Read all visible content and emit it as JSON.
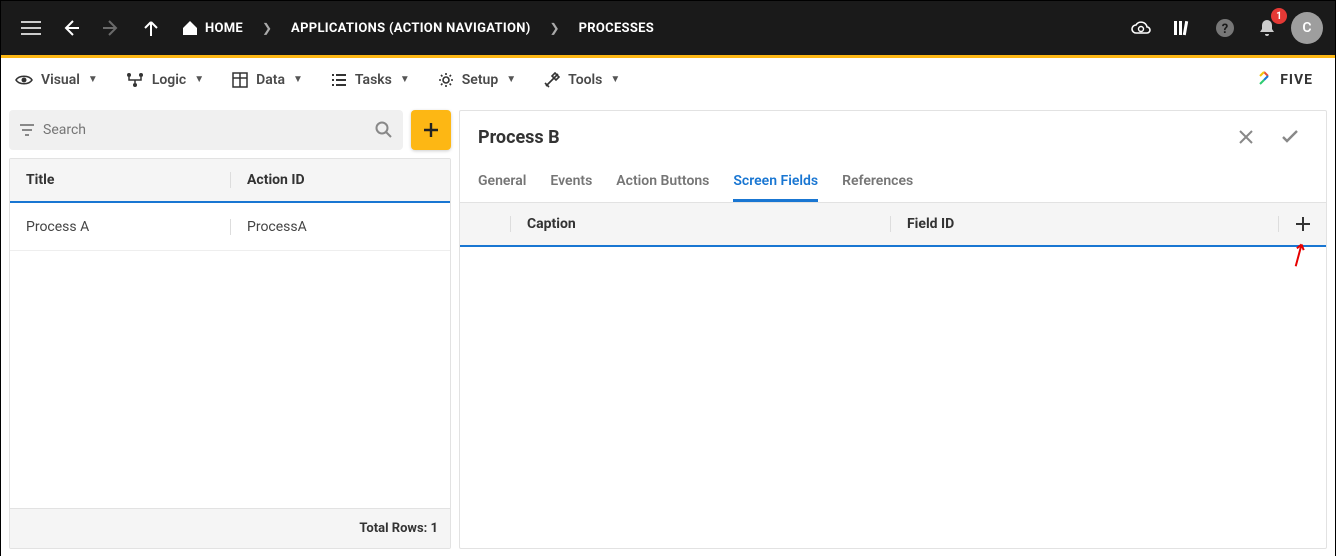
{
  "topbar": {
    "home_label": "HOME",
    "crumb1": "APPLICATIONS (ACTION NAVIGATION)",
    "crumb2": "PROCESSES",
    "notif_count": "1",
    "avatar_letter": "C"
  },
  "toolbar": {
    "visual": "Visual",
    "logic": "Logic",
    "data": "Data",
    "tasks": "Tasks",
    "setup": "Setup",
    "tools": "Tools",
    "logo": "FIVE"
  },
  "left": {
    "search_placeholder": "Search",
    "col_title": "Title",
    "col_actionid": "Action ID",
    "rows": [
      {
        "title": "Process A",
        "actionid": "ProcessA"
      }
    ],
    "total_label": "Total Rows: 1"
  },
  "right": {
    "title": "Process B",
    "tabs": {
      "general": "General",
      "events": "Events",
      "action_buttons": "Action Buttons",
      "screen_fields": "Screen Fields",
      "references": "References"
    },
    "active_tab": "screen_fields",
    "sub_cols": {
      "caption": "Caption",
      "fieldid": "Field ID"
    }
  }
}
